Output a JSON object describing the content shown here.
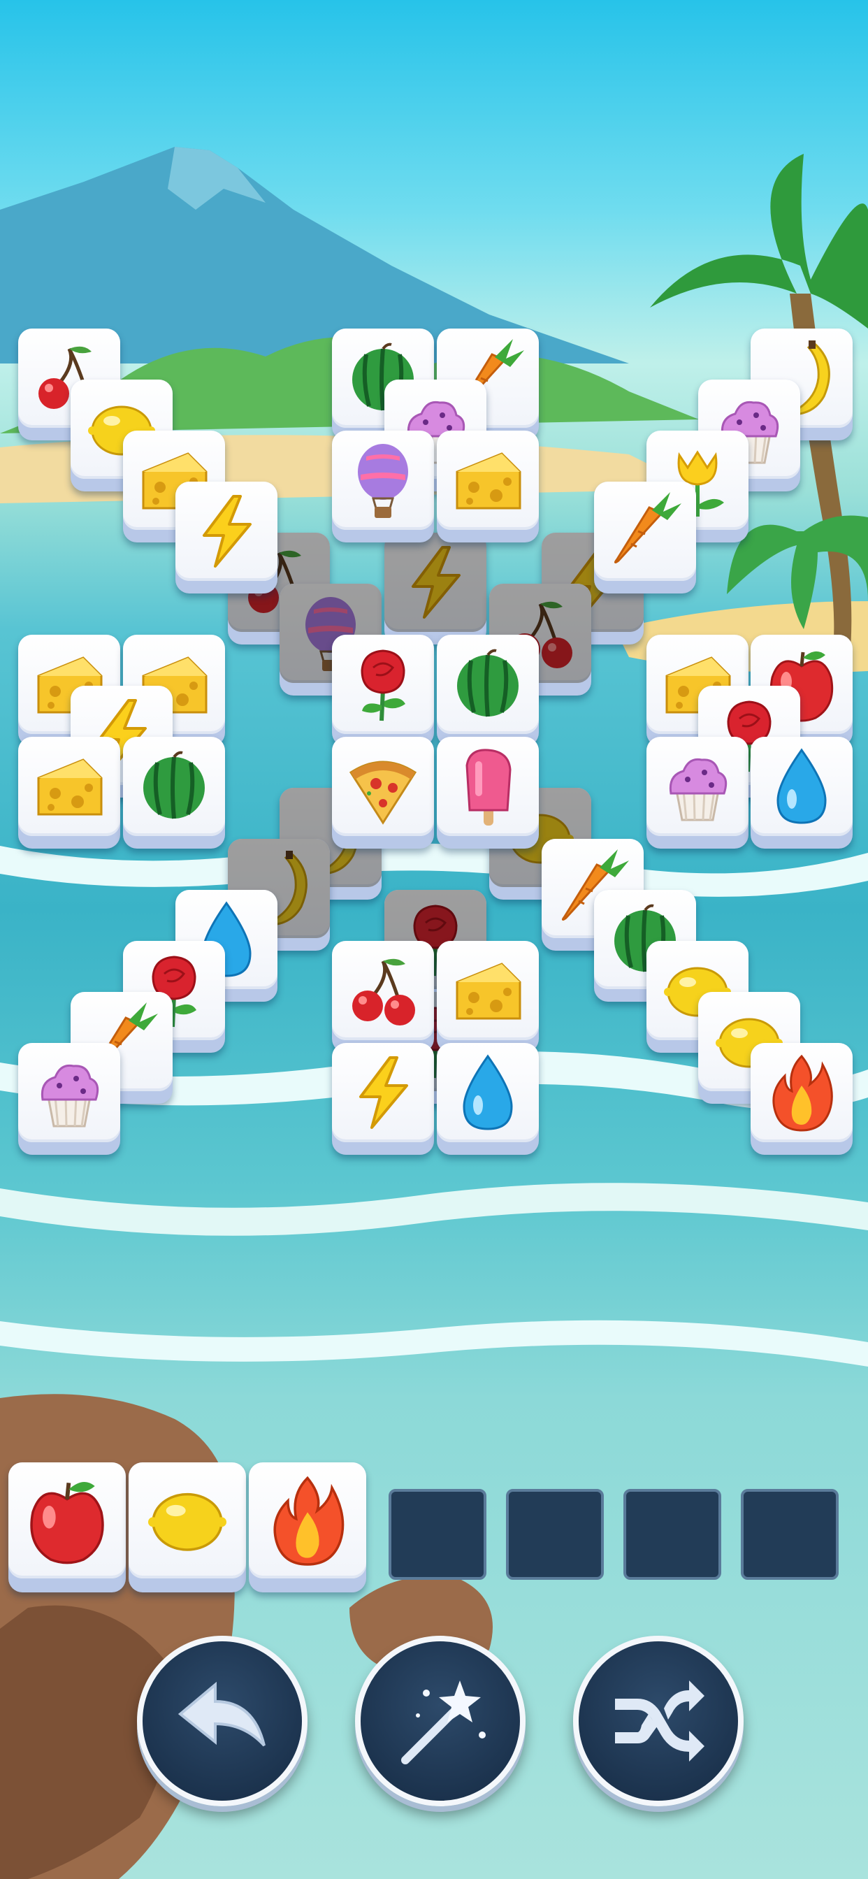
{
  "game": {
    "background_scene": "tropical-beach",
    "board_tiles": [
      {
        "icon": "cherry",
        "col": 0,
        "row": 0,
        "dim": false
      },
      {
        "icon": "lemon",
        "col": 1,
        "row": 1,
        "dim": false
      },
      {
        "icon": "cheese",
        "col": 2,
        "row": 2,
        "dim": false
      },
      {
        "icon": "lightning",
        "col": 3,
        "row": 3,
        "dim": false
      },
      {
        "icon": "cherry",
        "col": 4,
        "row": 4,
        "dim": true
      },
      {
        "icon": "balloon",
        "col": 5,
        "row": 5,
        "dim": true
      },
      {
        "icon": "watermelon",
        "col": 6,
        "row": 0,
        "dim": false
      },
      {
        "icon": "carrot",
        "col": 8,
        "row": 0,
        "dim": false
      },
      {
        "icon": "cupcake",
        "col": 7,
        "row": 1,
        "dim": false
      },
      {
        "icon": "balloon",
        "col": 6,
        "row": 2,
        "dim": false
      },
      {
        "icon": "cheese",
        "col": 8,
        "row": 2,
        "dim": false
      },
      {
        "icon": "lightning",
        "col": 7,
        "row": 4,
        "dim": true
      },
      {
        "icon": "banana",
        "col": 14,
        "row": 0,
        "dim": false
      },
      {
        "icon": "cupcake",
        "col": 13,
        "row": 1,
        "dim": false
      },
      {
        "icon": "tulip",
        "col": 12,
        "row": 2,
        "dim": false
      },
      {
        "icon": "carrot",
        "col": 11,
        "row": 3,
        "dim": false
      },
      {
        "icon": "lightning",
        "col": 10,
        "row": 4,
        "dim": true
      },
      {
        "icon": "cherry",
        "col": 9,
        "row": 5,
        "dim": true
      },
      {
        "icon": "cheese",
        "col": 0,
        "row": 6,
        "dim": false
      },
      {
        "icon": "cheese",
        "col": 2,
        "row": 6,
        "dim": false
      },
      {
        "icon": "lightning",
        "col": 1,
        "row": 7,
        "dim": false
      },
      {
        "icon": "cheese",
        "col": 0,
        "row": 8,
        "dim": false
      },
      {
        "icon": "watermelon",
        "col": 2,
        "row": 8,
        "dim": false
      },
      {
        "icon": "rose",
        "col": 6,
        "row": 6,
        "dim": false
      },
      {
        "icon": "watermelon",
        "col": 8,
        "row": 6,
        "dim": false
      },
      {
        "icon": "pizza",
        "col": 6,
        "row": 8,
        "dim": false
      },
      {
        "icon": "popsicle",
        "col": 8,
        "row": 8,
        "dim": false
      },
      {
        "icon": "cheese",
        "col": 12,
        "row": 6,
        "dim": false
      },
      {
        "icon": "apple",
        "col": 14,
        "row": 6,
        "dim": false
      },
      {
        "icon": "rose",
        "col": 13,
        "row": 7,
        "dim": false
      },
      {
        "icon": "cupcake",
        "col": 12,
        "row": 8,
        "dim": false
      },
      {
        "icon": "water-drop",
        "col": 14,
        "row": 8,
        "dim": false
      },
      {
        "icon": "banana",
        "col": 5,
        "row": 9,
        "dim": true
      },
      {
        "icon": "banana",
        "col": 4,
        "row": 10,
        "dim": true
      },
      {
        "icon": "water-drop",
        "col": 3,
        "row": 11,
        "dim": false
      },
      {
        "icon": "rose",
        "col": 2,
        "row": 12,
        "dim": false
      },
      {
        "icon": "carrot",
        "col": 1,
        "row": 13,
        "dim": false
      },
      {
        "icon": "cupcake",
        "col": 0,
        "row": 14,
        "dim": false
      },
      {
        "icon": "lemon",
        "col": 9,
        "row": 9,
        "dim": true
      },
      {
        "icon": "carrot",
        "col": 10,
        "row": 10,
        "dim": false
      },
      {
        "icon": "watermelon",
        "col": 11,
        "row": 11,
        "dim": false
      },
      {
        "icon": "lemon",
        "col": 12,
        "row": 12,
        "dim": false
      },
      {
        "icon": "lemon",
        "col": 13,
        "row": 13,
        "dim": false
      },
      {
        "icon": "fire",
        "col": 14,
        "row": 14,
        "dim": false
      },
      {
        "icon": "rose",
        "col": 7,
        "row": 11,
        "dim": true
      },
      {
        "icon": "cherry",
        "col": 6,
        "row": 12,
        "dim": false
      },
      {
        "icon": "cheese",
        "col": 8,
        "row": 12,
        "dim": false
      },
      {
        "icon": "rose",
        "col": 7,
        "row": 13,
        "dim": true
      },
      {
        "icon": "lightning",
        "col": 6,
        "row": 14,
        "dim": false
      },
      {
        "icon": "water-drop",
        "col": 8,
        "row": 14,
        "dim": false
      }
    ],
    "tray": {
      "capacity": 7,
      "tiles": [
        {
          "icon": "apple"
        },
        {
          "icon": "lemon"
        },
        {
          "icon": "fire"
        }
      ]
    },
    "actions": [
      {
        "name": "undo-button",
        "icon": "undo-arrow-icon"
      },
      {
        "name": "hint-button",
        "icon": "magic-wand-icon"
      },
      {
        "name": "shuffle-button",
        "icon": "shuffle-icon"
      }
    ],
    "colors": {
      "tray_slot": "#223c57",
      "button_bg": "#1c3350",
      "tile_face": "#ffffff"
    }
  }
}
